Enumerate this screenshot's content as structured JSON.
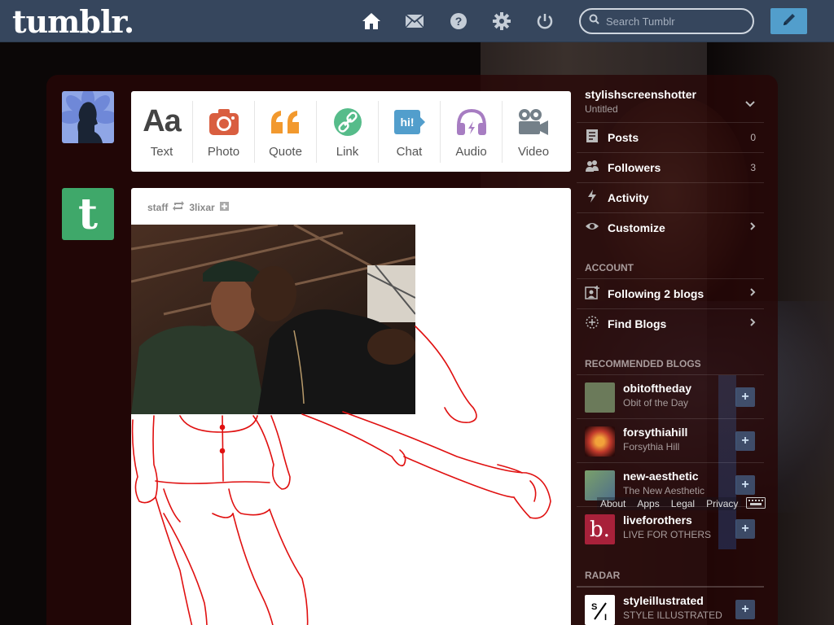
{
  "app": {
    "logo": "tumblr."
  },
  "header": {
    "search_placeholder": "Search Tumblr",
    "nav": [
      "home-icon",
      "mail-icon",
      "help-icon",
      "gear-icon",
      "power-icon"
    ],
    "compose": "pencil-icon"
  },
  "post_types": [
    {
      "label": "Text",
      "icon": "text-icon",
      "color": "#444444"
    },
    {
      "label": "Photo",
      "icon": "camera-icon",
      "color": "#d95e40"
    },
    {
      "label": "Quote",
      "icon": "quote-icon",
      "color": "#f2992e"
    },
    {
      "label": "Link",
      "icon": "link-icon",
      "color": "#56bc8a"
    },
    {
      "label": "Chat",
      "icon": "chat-icon",
      "color": "#529ecc"
    },
    {
      "label": "Audio",
      "icon": "headphones-icon",
      "color": "#a77dc2"
    },
    {
      "label": "Video",
      "icon": "video-icon",
      "color": "#748089"
    }
  ],
  "post": {
    "author": "staff",
    "reblogged_from": "3lixar"
  },
  "sidebar": {
    "blog_name": "stylishscreenshotter",
    "blog_title": "Untitled",
    "items": [
      {
        "label": "Posts",
        "count": "0",
        "icon": "posts-icon"
      },
      {
        "label": "Followers",
        "count": "3",
        "icon": "followers-icon"
      },
      {
        "label": "Activity",
        "count": "",
        "icon": "lightning-icon"
      },
      {
        "label": "Customize",
        "count": "",
        "icon": "eye-icon"
      }
    ],
    "account_title": "ACCOUNT",
    "account_items": [
      {
        "label": "Following 2 blogs",
        "icon": "following-icon"
      },
      {
        "label": "Find Blogs",
        "icon": "find-icon"
      }
    ],
    "recommended_title": "RECOMMENDED BLOGS",
    "recommended": [
      {
        "name": "obitoftheday",
        "desc": "Obit of the Day",
        "color": "#6b7a5a"
      },
      {
        "name": "forsythiahill",
        "desc": "Forsythia Hill",
        "color": "#c0392b"
      },
      {
        "name": "new-aesthetic",
        "desc": "The New Aesthetic",
        "color": "#6d8a5e"
      },
      {
        "name": "liveforothers",
        "desc": "LIVE FOR OTHERS",
        "color": "#a8213a"
      }
    ],
    "footer_links": [
      "About",
      "Apps",
      "Legal",
      "Privacy"
    ],
    "radar_title": "RADAR",
    "radar": {
      "name": "styleillustrated",
      "desc": "STYLE ILLUSTRATED"
    }
  }
}
